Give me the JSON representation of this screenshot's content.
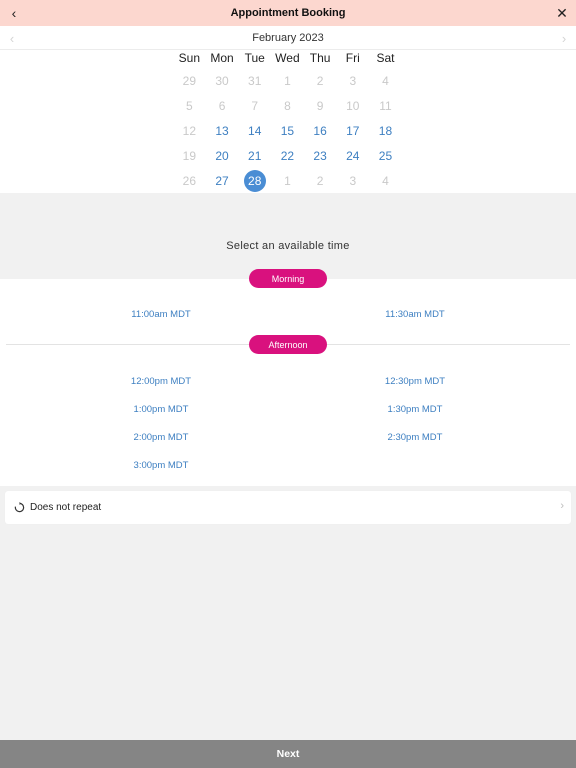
{
  "header": {
    "title": "Appointment Booking",
    "back_icon": "chevron-left-icon",
    "close_icon": "close-icon"
  },
  "calendar": {
    "month_label": "February 2023",
    "weekdays": [
      "Sun",
      "Mon",
      "Tue",
      "Wed",
      "Thu",
      "Fri",
      "Sat"
    ],
    "weeks": [
      [
        {
          "d": "29",
          "s": "dim"
        },
        {
          "d": "30",
          "s": "dim"
        },
        {
          "d": "31",
          "s": "dim"
        },
        {
          "d": "1",
          "s": "dim"
        },
        {
          "d": "2",
          "s": "dim"
        },
        {
          "d": "3",
          "s": "dim"
        },
        {
          "d": "4",
          "s": "dim"
        }
      ],
      [
        {
          "d": "5",
          "s": "dim"
        },
        {
          "d": "6",
          "s": "dim"
        },
        {
          "d": "7",
          "s": "dim"
        },
        {
          "d": "8",
          "s": "dim"
        },
        {
          "d": "9",
          "s": "dim"
        },
        {
          "d": "10",
          "s": "dim"
        },
        {
          "d": "11",
          "s": "dim"
        }
      ],
      [
        {
          "d": "12",
          "s": "dim"
        },
        {
          "d": "13",
          "s": "on"
        },
        {
          "d": "14",
          "s": "on"
        },
        {
          "d": "15",
          "s": "on"
        },
        {
          "d": "16",
          "s": "on"
        },
        {
          "d": "17",
          "s": "on"
        },
        {
          "d": "18",
          "s": "on"
        }
      ],
      [
        {
          "d": "19",
          "s": "dim"
        },
        {
          "d": "20",
          "s": "on"
        },
        {
          "d": "21",
          "s": "on"
        },
        {
          "d": "22",
          "s": "on"
        },
        {
          "d": "23",
          "s": "on"
        },
        {
          "d": "24",
          "s": "on"
        },
        {
          "d": "25",
          "s": "on"
        }
      ],
      [
        {
          "d": "26",
          "s": "dim"
        },
        {
          "d": "27",
          "s": "on"
        },
        {
          "d": "28",
          "s": "sel"
        },
        {
          "d": "1",
          "s": "dim"
        },
        {
          "d": "2",
          "s": "dim"
        },
        {
          "d": "3",
          "s": "dim"
        },
        {
          "d": "4",
          "s": "dim"
        }
      ]
    ]
  },
  "times": {
    "prompt": "Select an available time",
    "morning_label": "Morning",
    "morning": [
      "11:00am MDT",
      "11:30am MDT"
    ],
    "afternoon_label": "Afternoon",
    "afternoon": [
      "12:00pm MDT",
      "12:30pm MDT",
      "1:00pm MDT",
      "1:30pm MDT",
      "2:00pm MDT",
      "2:30pm MDT",
      "3:00pm MDT"
    ]
  },
  "repeat": {
    "label": "Does not repeat",
    "icon": "repeat-icon"
  },
  "footer": {
    "next_label": "Next"
  },
  "colors": {
    "header_bg": "#fcd7cf",
    "accent_pink": "#d9117e",
    "link_blue": "#3d7fc1",
    "selected_day": "#4a8dd4",
    "footer_bg": "#858585"
  }
}
